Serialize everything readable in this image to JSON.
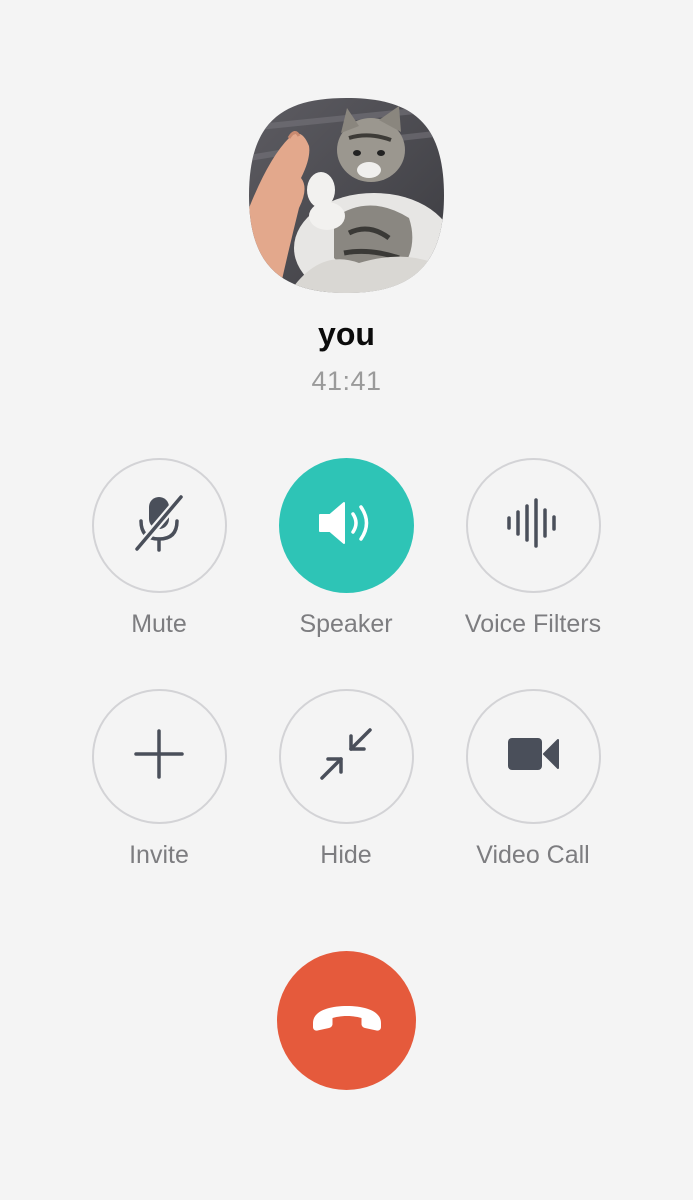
{
  "call": {
    "caller_name": "you",
    "duration": "41:41"
  },
  "controls": {
    "row1": [
      {
        "label": "Mute",
        "icon": "mic-off-icon",
        "active": false
      },
      {
        "label": "Speaker",
        "icon": "speaker-icon",
        "active": true
      },
      {
        "label": "Voice Filters",
        "icon": "soundwave-icon",
        "active": false
      }
    ],
    "row2": [
      {
        "label": "Invite",
        "icon": "plus-icon",
        "active": false
      },
      {
        "label": "Hide",
        "icon": "minimize-arrows-icon",
        "active": false
      },
      {
        "label": "Video Call",
        "icon": "video-camera-icon",
        "active": false
      }
    ]
  },
  "end_call": {
    "icon": "phone-hangup-icon"
  },
  "colors": {
    "background": "#f4f4f4",
    "accent_active": "#2ec4b6",
    "end_call": "#e55a3c",
    "icon": "#4a4f5a",
    "label": "#7d7d80"
  }
}
